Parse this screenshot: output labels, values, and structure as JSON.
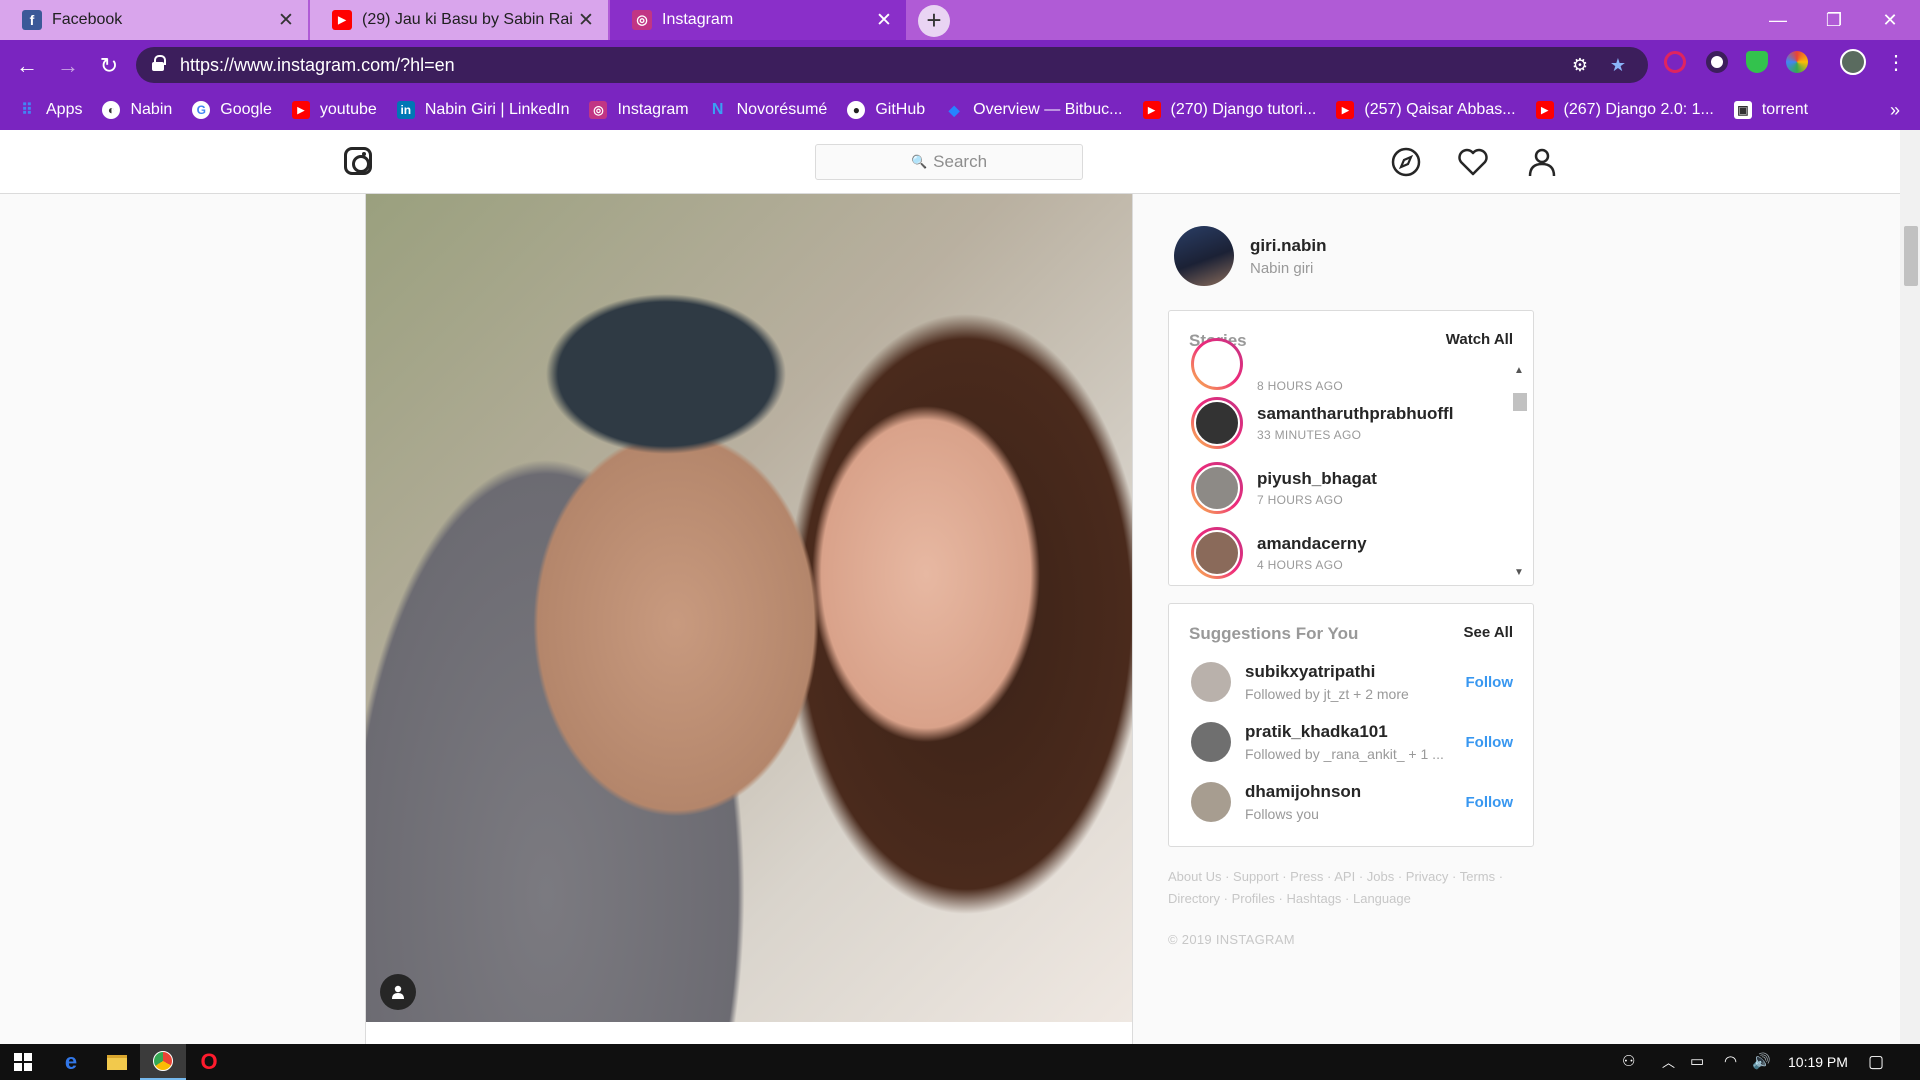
{
  "browser": {
    "tabs": [
      {
        "title": "Facebook",
        "icon": "facebook-icon",
        "color": "#3b5998",
        "glyph": "f"
      },
      {
        "title": "(29) Jau ki Basu by Sabin Rai",
        "icon": "youtube-icon",
        "color": "#ff0000",
        "glyph": "▶"
      },
      {
        "title": "Instagram",
        "icon": "instagram-icon",
        "color": "#c13584",
        "glyph": "◎"
      }
    ],
    "new_tab": "+",
    "window": {
      "minimize": "—",
      "restore": "❐",
      "close": "✕"
    },
    "url": "https://www.instagram.com/?hl=en",
    "bookmarks": [
      {
        "label": "Apps",
        "color": "#4285f4",
        "glyph": "⠿"
      },
      {
        "label": "Nabin",
        "color": "#555",
        "glyph": "◐"
      },
      {
        "label": "Google",
        "color": "#ffffff",
        "glyph": "G"
      },
      {
        "label": "youtube",
        "color": "#ff0000",
        "glyph": "▶"
      },
      {
        "label": "Nabin Giri | LinkedIn",
        "color": "#0077b5",
        "glyph": "in"
      },
      {
        "label": "Instagram",
        "color": "#c13584",
        "glyph": "◎"
      },
      {
        "label": "Novorésumé",
        "color": "#3aa0f3",
        "glyph": "N"
      },
      {
        "label": "GitHub",
        "color": "#222",
        "glyph": "●"
      },
      {
        "label": "Overview — Bitbuc...",
        "color": "#2684ff",
        "glyph": "◆"
      },
      {
        "label": "(270) Django tutori...",
        "color": "#ff0000",
        "glyph": "▶"
      },
      {
        "label": "(257) Qaisar Abbas...",
        "color": "#ff0000",
        "glyph": "▶"
      },
      {
        "label": "(267) Django 2.0: 1...",
        "color": "#ff0000",
        "glyph": "▶"
      },
      {
        "label": "torrent",
        "color": "#333",
        "glyph": "▣"
      }
    ],
    "bookmarks_more": "»"
  },
  "instagram": {
    "search_placeholder": "Search",
    "me": {
      "username": "giri.nabin",
      "full_name": "Nabin giri"
    },
    "stories": {
      "title": "Stories",
      "action": "Watch All",
      "items": [
        {
          "username": "",
          "time": "8 HOURS AGO"
        },
        {
          "username": "samantharuthprabhuoffl",
          "time": "33 MINUTES AGO"
        },
        {
          "username": "piyush_bhagat",
          "time": "7 HOURS AGO"
        },
        {
          "username": "amandacerny",
          "time": "4 HOURS AGO"
        }
      ]
    },
    "suggestions": {
      "title": "Suggestions For You",
      "action": "See All",
      "items": [
        {
          "username": "subikxyatripathi",
          "sub": "Followed by jt_zt + 2 more",
          "button": "Follow"
        },
        {
          "username": "pratik_khadka101",
          "sub": "Followed by _rana_ankit_ + 1 ...",
          "button": "Follow"
        },
        {
          "username": "dhamijohnson",
          "sub": "Follows you",
          "button": "Follow"
        }
      ]
    },
    "footer_links": [
      "About Us",
      "Support",
      "Press",
      "API",
      "Jobs",
      "Privacy",
      "Terms",
      "Directory",
      "Profiles",
      "Hashtags",
      "Language"
    ],
    "copyright": "© 2019 INSTAGRAM"
  },
  "taskbar": {
    "time": "10:19 PM"
  }
}
